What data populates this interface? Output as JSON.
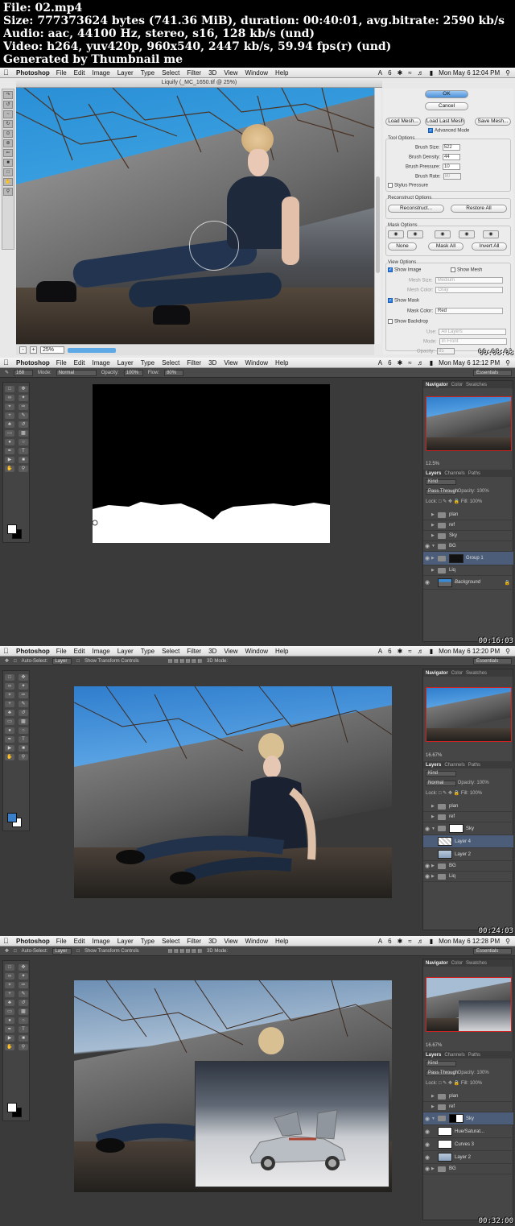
{
  "header_info": {
    "line1": "File: 02.mp4",
    "line2": "Size: 777373624 bytes (741.36 MiB), duration: 00:40:01, avg.bitrate: 2590 kb/s",
    "line3": "Audio: aac, 44100 Hz, stereo, s16, 128 kb/s (und)",
    "line4": "Video: h264, yuv420p, 960x540, 2447 kb/s, 59.94 fps(r) (und)",
    "line5": "Generated by Thumbnail me"
  },
  "menubar": {
    "app": "Photoshop",
    "items": [
      "File",
      "Edit",
      "Image",
      "Layer",
      "Type",
      "Select",
      "Filter",
      "3D",
      "View",
      "Window",
      "Help"
    ],
    "tray_icons": [
      "adobe-icon",
      "bluetooth-icon",
      "wifi-icon",
      "volume-icon",
      "battery-icon"
    ],
    "tray_badge": "6"
  },
  "frames": [
    {
      "clock": "Mon May 6  12:04 PM",
      "timecode": "00:08:03",
      "window_title": "Liquify (_MC_1650.tif @ 25%)",
      "zoom": "25%",
      "buttons": {
        "ok": "OK",
        "cancel": "Cancel",
        "load_mesh": "Load Mesh...",
        "load_last_mesh": "Load Last Mesh",
        "save_mesh": "Save Mesh..."
      },
      "advanced_mode": "Advanced Mode",
      "tool_options": {
        "title": "Tool Options",
        "brush_size": {
          "label": "Brush Size:",
          "value": "522"
        },
        "brush_density": {
          "label": "Brush Density:",
          "value": "44"
        },
        "brush_pressure": {
          "label": "Brush Pressure:",
          "value": "10"
        },
        "brush_rate": {
          "label": "Brush Rate:",
          "value": "80"
        },
        "stylus": "Stylus Pressure"
      },
      "reconstruct": {
        "title": "Reconstruct Options",
        "reconstruct": "Reconstruct...",
        "restore_all": "Restore All"
      },
      "mask": {
        "title": "Mask Options",
        "none": "None",
        "mask_all": "Mask All",
        "invert_all": "Invert All"
      },
      "view": {
        "title": "View Options",
        "show_image": "Show Image",
        "show_mesh": "Show Mesh",
        "mesh_size": {
          "label": "Mesh Size:",
          "value": "Medium"
        },
        "mesh_color": {
          "label": "Mesh Color:",
          "value": "Gray"
        },
        "show_mask": "Show Mask",
        "mask_color": {
          "label": "Mask Color:",
          "value": "Red"
        },
        "show_backdrop": "Show Backdrop",
        "use": {
          "label": "Use:",
          "value": "All Layers"
        },
        "mode": {
          "label": "Mode:",
          "value": "In Front"
        },
        "opacity": {
          "label": "Opacity:",
          "value": "85"
        }
      }
    },
    {
      "clock": "Mon May 6  12:12 PM",
      "timecode": "00:16:03",
      "optbar": {
        "brush_size": "168",
        "mode_label": "Mode:",
        "mode": "Normal",
        "opacity_label": "Opacity:",
        "opacity": "100%",
        "flow_label": "Flow:",
        "flow": "80%",
        "workspace": "Essentials"
      },
      "panel_tabs": [
        "Navigator",
        "Color",
        "Swatches"
      ],
      "nav_zoom": "12.5%",
      "layer_tabs": [
        "Layers",
        "Channels",
        "Paths"
      ],
      "kind": "Kind",
      "blend_mode": "Pass Through",
      "opacity": "Opacity:",
      "opacity_value": "100%",
      "lock": "Lock:",
      "fill": "Fill:",
      "fill_value": "100%",
      "layers": [
        "plan",
        "ref",
        "Sky",
        "BG",
        "Group 1",
        "Liq",
        "Background"
      ]
    },
    {
      "clock": "Mon May 6  12:20 PM",
      "timecode": "00:24:03",
      "optbar": {
        "auto_select": "Auto-Select:",
        "target": "Layer",
        "transform": "Show Transform Controls",
        "mode3d": "3D Mode:",
        "workspace": "Essentials"
      },
      "panel_tabs": [
        "Navigator",
        "Color",
        "Swatches"
      ],
      "nav_zoom": "16.67%",
      "layer_tabs": [
        "Layers",
        "Channels",
        "Paths"
      ],
      "kind": "Kind",
      "blend_mode": "Normal",
      "opacity": "Opacity:",
      "opacity_value": "100%",
      "lock": "Lock:",
      "fill": "Fill:",
      "fill_value": "100%",
      "layers": [
        "plan",
        "ref",
        "Sky",
        "Layer 4",
        "Layer 2",
        "BG",
        "Liq"
      ]
    },
    {
      "clock": "Mon May 6  12:28 PM",
      "timecode": "00:32:00",
      "optbar": {
        "auto_select": "Auto-Select:",
        "target": "Layer",
        "transform": "Show Transform Controls",
        "mode3d": "3D Mode:",
        "workspace": "Essentials"
      },
      "panel_tabs": [
        "Navigator",
        "Color",
        "Swatches"
      ],
      "nav_zoom": "16.67%",
      "layer_tabs": [
        "Layers",
        "Channels",
        "Paths"
      ],
      "kind": "Kind",
      "blend_mode": "Pass Through",
      "opacity": "Opacity:",
      "opacity_value": "100%",
      "lock": "Lock:",
      "fill": "Fill:",
      "fill_value": "100%",
      "layers": [
        "plan",
        "ref",
        "Sky",
        "Hue/Saturat...",
        "Curves 3",
        "Layer 2",
        "BG"
      ]
    }
  ],
  "colors": {
    "sky": "#3a95dc",
    "selection": "#4b5d79",
    "accent_red": "#cc2222",
    "fg_swatch_frame3": "#3a7fc8"
  }
}
